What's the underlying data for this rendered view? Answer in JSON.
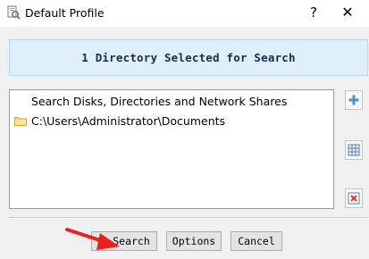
{
  "window": {
    "title": "Default Profile",
    "help_glyph": "?",
    "close_glyph": "✕"
  },
  "banner": {
    "text": "1 Directory Selected for Search"
  },
  "list": {
    "items": [
      {
        "label": "Search Disks, Directories and Network Shares",
        "icon": "none"
      },
      {
        "label": "C:\\Users\\Administrator\\Documents",
        "icon": "folder-icon"
      }
    ]
  },
  "side_buttons": [
    {
      "icon": "add-icon"
    },
    {
      "icon": "grid-icon"
    },
    {
      "icon": "remove-icon"
    }
  ],
  "buttons": {
    "search": "Search",
    "options": "Options",
    "cancel": "Cancel"
  },
  "colors": {
    "banner_bg": "#dff0fa",
    "banner_text": "#0f2f52",
    "annotation_arrow": "#e8231d"
  }
}
